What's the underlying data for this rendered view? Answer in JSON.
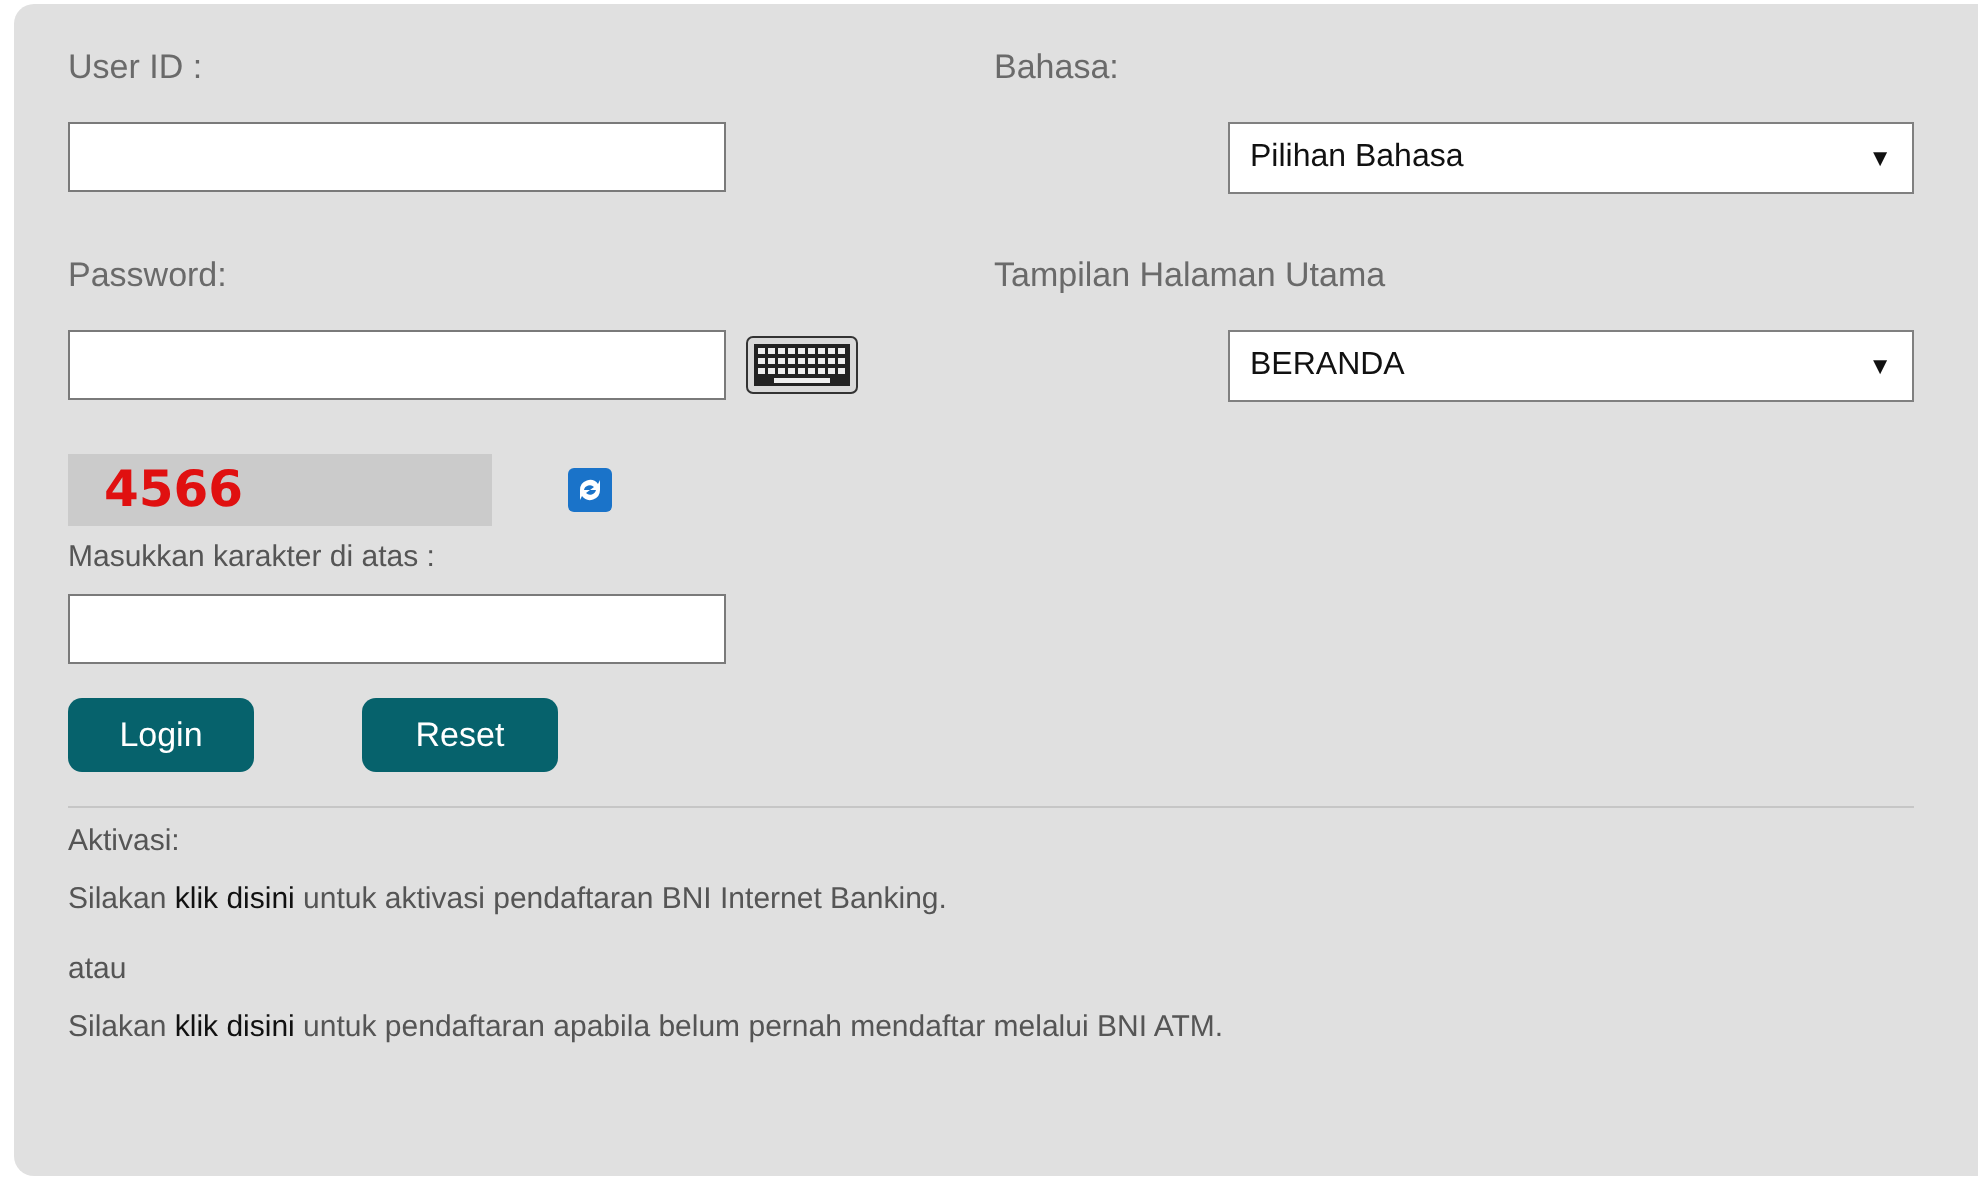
{
  "login": {
    "user_id": {
      "label": "User ID :"
    },
    "password": {
      "label": "Password:"
    },
    "captcha": {
      "code": "4566",
      "label": "Masukkan karakter di atas :"
    },
    "buttons": [
      {
        "label": "Login"
      },
      {
        "label": "Reset"
      }
    ]
  },
  "settings": [
    {
      "label": "Bahasa:",
      "value": "Pilihan Bahasa",
      "arrow": "▼"
    },
    {
      "label": "Tampilan Halaman Utama",
      "value": "BERANDA",
      "arrow": "▼"
    }
  ],
  "activation": {
    "heading": "Aktivasi:",
    "separator": "atau",
    "lines": [
      {
        "before": "Silakan ",
        "link": "klik disini",
        "after": " untuk aktivasi pendaftaran BNI Internet Banking."
      },
      {
        "before": "Silakan ",
        "link": "klik disini",
        "after": " untuk pendaftaran apabila belum pernah mendaftar melalui BNI ATM."
      }
    ]
  }
}
